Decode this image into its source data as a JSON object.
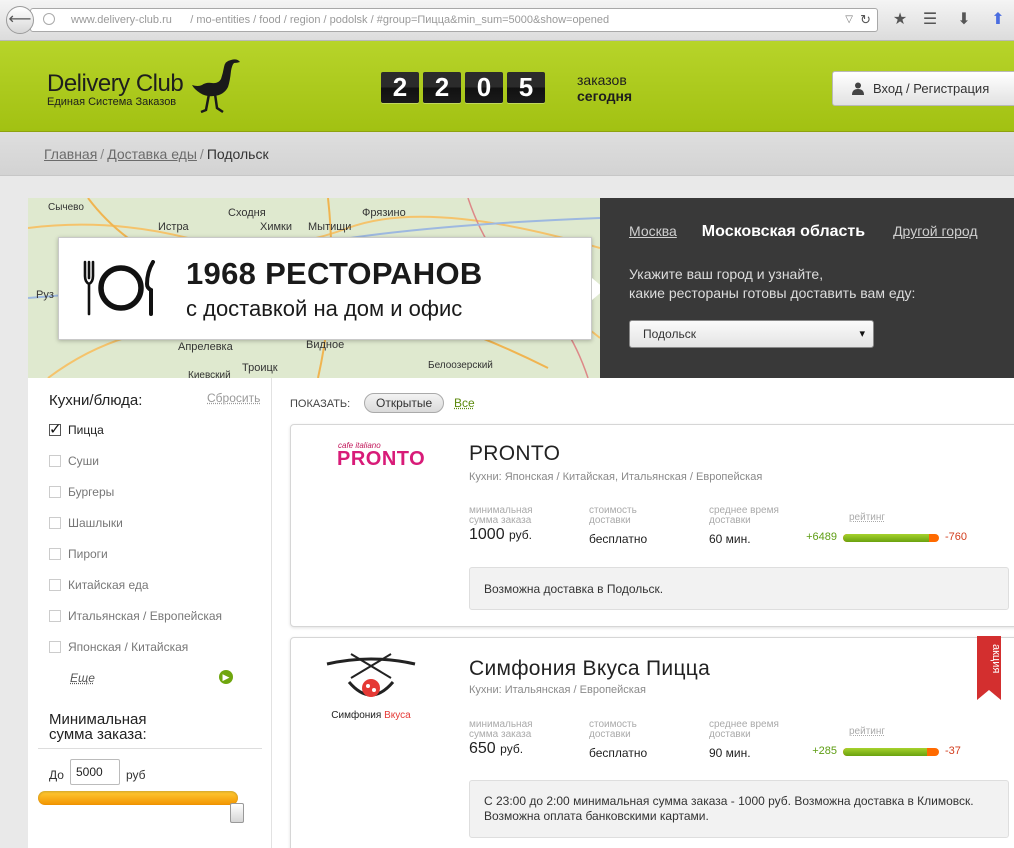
{
  "browser": {
    "url_domain": "www.delivery-club.ru",
    "url_path": "/ mo-entities / food / region / podolsk / #group=Пицца&min_sum=5000&show=opened"
  },
  "header": {
    "logo_title": "Delivery Club",
    "logo_subtitle": "Единая Система Заказов",
    "counter_digits": [
      "2",
      "2",
      "0",
      "5"
    ],
    "counter_label_1": "заказов",
    "counter_label_2": "сегодня",
    "login_label": "Вход / Регистрация"
  },
  "breadcrumb": {
    "home": "Главная",
    "delivery": "Доставка еды",
    "current": "Подольск",
    "sep": "/"
  },
  "hero": {
    "headline": "1968 РЕСТОРАНОВ",
    "subline": "с доставкой на дом и офис",
    "map_labels": [
      "Сычево",
      "Истра",
      "Сходня",
      "Химки",
      "Мытищи",
      "Фрязино",
      "Руз",
      "Апрелевка",
      "Видное",
      "Киевский",
      "Троицк",
      "Белоозерский"
    ]
  },
  "region": {
    "tabs": [
      "Москва",
      "Московская область",
      "Другой город"
    ],
    "active_tab": "Московская область",
    "text_line1": "Укажите ваш город и узнайте,",
    "text_line2": "какие рестораны готовы доставить вам еду:",
    "city_value": "Подольск"
  },
  "filters": {
    "title": "Кухни/блюда:",
    "reset": "Сбросить",
    "items": [
      {
        "label": "Пицца",
        "checked": true
      },
      {
        "label": "Суши",
        "checked": false
      },
      {
        "label": "Бургеры",
        "checked": false
      },
      {
        "label": "Шашлыки",
        "checked": false
      },
      {
        "label": "Пироги",
        "checked": false
      },
      {
        "label": "Китайская еда",
        "checked": false
      },
      {
        "label": "Итальянская / Европейская",
        "checked": false
      },
      {
        "label": "Японская / Китайская",
        "checked": false
      }
    ],
    "more": "Еще",
    "min_title_1": "Минимальная",
    "min_title_2": "сумма заказа:",
    "min_pre": "До",
    "min_value": "5000",
    "min_post": "руб",
    "min_slider_fraction": 1.0
  },
  "listing": {
    "show_label": "ПОКАЗАТЬ:",
    "show_opened": "Открытые",
    "show_all": "Все"
  },
  "labels": {
    "min_sum_1": "минимальная",
    "min_sum_2": "сумма заказа",
    "cost_1": "стоимость",
    "cost_2": "доставки",
    "time_1": "среднее время",
    "time_2": "доставки",
    "rating": "рейтинг",
    "currency": "руб."
  },
  "restaurants": [
    {
      "name": "PRONTO",
      "logo_small": "cafe italiano",
      "logo_big": "PRONTO",
      "cuisines": "Кухни: Японская / Китайская, Итальянская / Европейская",
      "min_sum": "1000",
      "delivery_cost": "бесплатно",
      "delivery_time": "60 мин.",
      "rating_pos": "+6489",
      "rating_neg": "-760",
      "rating_fraction": 0.9,
      "note": "Возможна доставка в Подольск.",
      "promo": ""
    },
    {
      "name": "Симфония Вкуса Пицца",
      "logo_word_1": "Симфония",
      "logo_word_2": "Вкуса",
      "cuisines": "Кухни: Итальянская / Европейская",
      "min_sum": "650",
      "delivery_cost": "бесплатно",
      "delivery_time": "90 мин.",
      "rating_pos": "+285",
      "rating_neg": "-37",
      "rating_fraction": 0.88,
      "note": "С 23:00 до 2:00 минимальная сумма заказа - 1000 руб. Возможна доставка в Климовск. Возможна оплата банковскими картами.",
      "promo": "акция"
    }
  ]
}
